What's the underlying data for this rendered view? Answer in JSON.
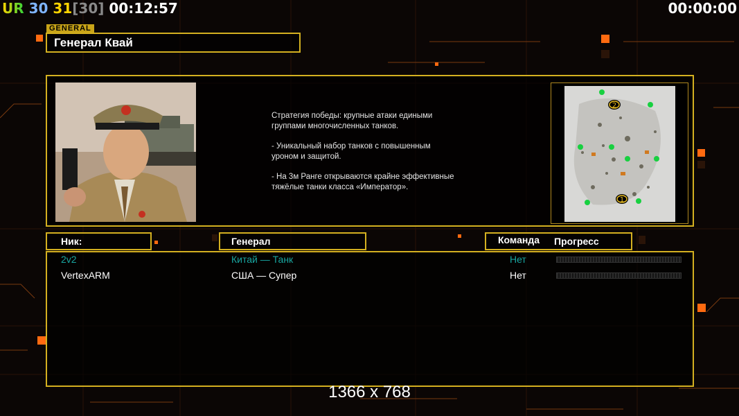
{
  "hud": {
    "ur_label": "UR",
    "fps_a": "30",
    "fps_b": "31",
    "fps_c": "[30]",
    "game_time": "00:12:57",
    "timer_right": "00:00:00"
  },
  "general_tag": "GENERAL",
  "general_name": "Генерал Квай",
  "description": [
    "Стратегия победы: крупные атаки едиными\n группами многочисленных танков.",
    "- Уникальный набор танков с повышенным\n уроном и защитой.",
    "- На 3м Ранге открываются крайне эффективные\n тяжёлые танки класса «Император»."
  ],
  "headers": {
    "nick": "Ник:",
    "general": "Генерал",
    "team": "Команда",
    "progress": "Прогресс"
  },
  "players": [
    {
      "nick": "2v2",
      "general": "Китай — Танк",
      "team": "Нет",
      "color": "#18a6a0"
    },
    {
      "nick": "VertexARM",
      "general": "США — Супер",
      "team": "Нет",
      "color": "#ffffff"
    }
  ],
  "minimap": {
    "slot_1": "1",
    "slot_2": "2",
    "money_icon": "$"
  },
  "resolution_label": "1366 x 768",
  "colors": {
    "gold": "#d4b020",
    "accent_orange": "#ff6a10",
    "teal": "#18a6a0"
  }
}
